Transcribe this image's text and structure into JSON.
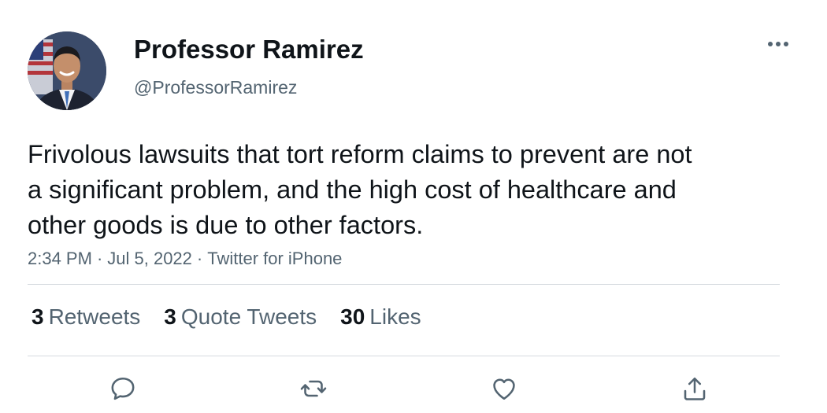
{
  "user": {
    "display_name": "Professor Ramirez",
    "handle": "@ProfessorRamirez"
  },
  "tweet": {
    "text": "Frivolous lawsuits that tort reform claims to prevent are not a significant problem, and the high cost of healthcare and other goods is due to other factors.",
    "time": "2:34 PM",
    "separator": "·",
    "date": "Jul 5, 2022",
    "source": "Twitter for iPhone"
  },
  "stats": {
    "retweets": {
      "count": "3",
      "label": "Retweets"
    },
    "quote_tweets": {
      "count": "3",
      "label": "Quote Tweets"
    },
    "likes": {
      "count": "30",
      "label": "Likes"
    }
  },
  "actions": {
    "reply_icon": "speech-bubble-icon",
    "retweet_icon": "retweet-arrows-icon",
    "like_icon": "heart-icon",
    "share_icon": "upload-share-icon"
  },
  "colors": {
    "text_primary": "#0f1419",
    "text_secondary": "#536471",
    "divider": "#d6dbdf"
  }
}
